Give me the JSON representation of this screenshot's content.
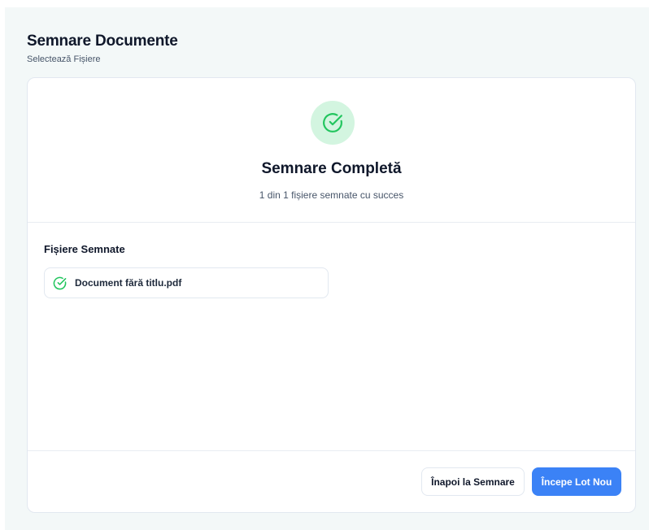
{
  "header": {
    "title": "Semnare Documente",
    "subtitle": "Selectează Fișiere"
  },
  "summary": {
    "icon": "check-circle-icon",
    "title": "Semnare Completă",
    "text": "1 din 1 fișiere semnate cu succes"
  },
  "files": {
    "heading": "Fișiere Semnate",
    "items": [
      {
        "icon": "check-circle-icon",
        "name": "Document fără titlu.pdf"
      }
    ]
  },
  "actions": {
    "back_label": "Înapoi la Semnare",
    "new_batch_label": "Începe Lot Nou"
  },
  "colors": {
    "background": "#f3f8f8",
    "success": "#22c55e",
    "success_bg": "#d3f5e0",
    "primary": "#3b82f6"
  }
}
